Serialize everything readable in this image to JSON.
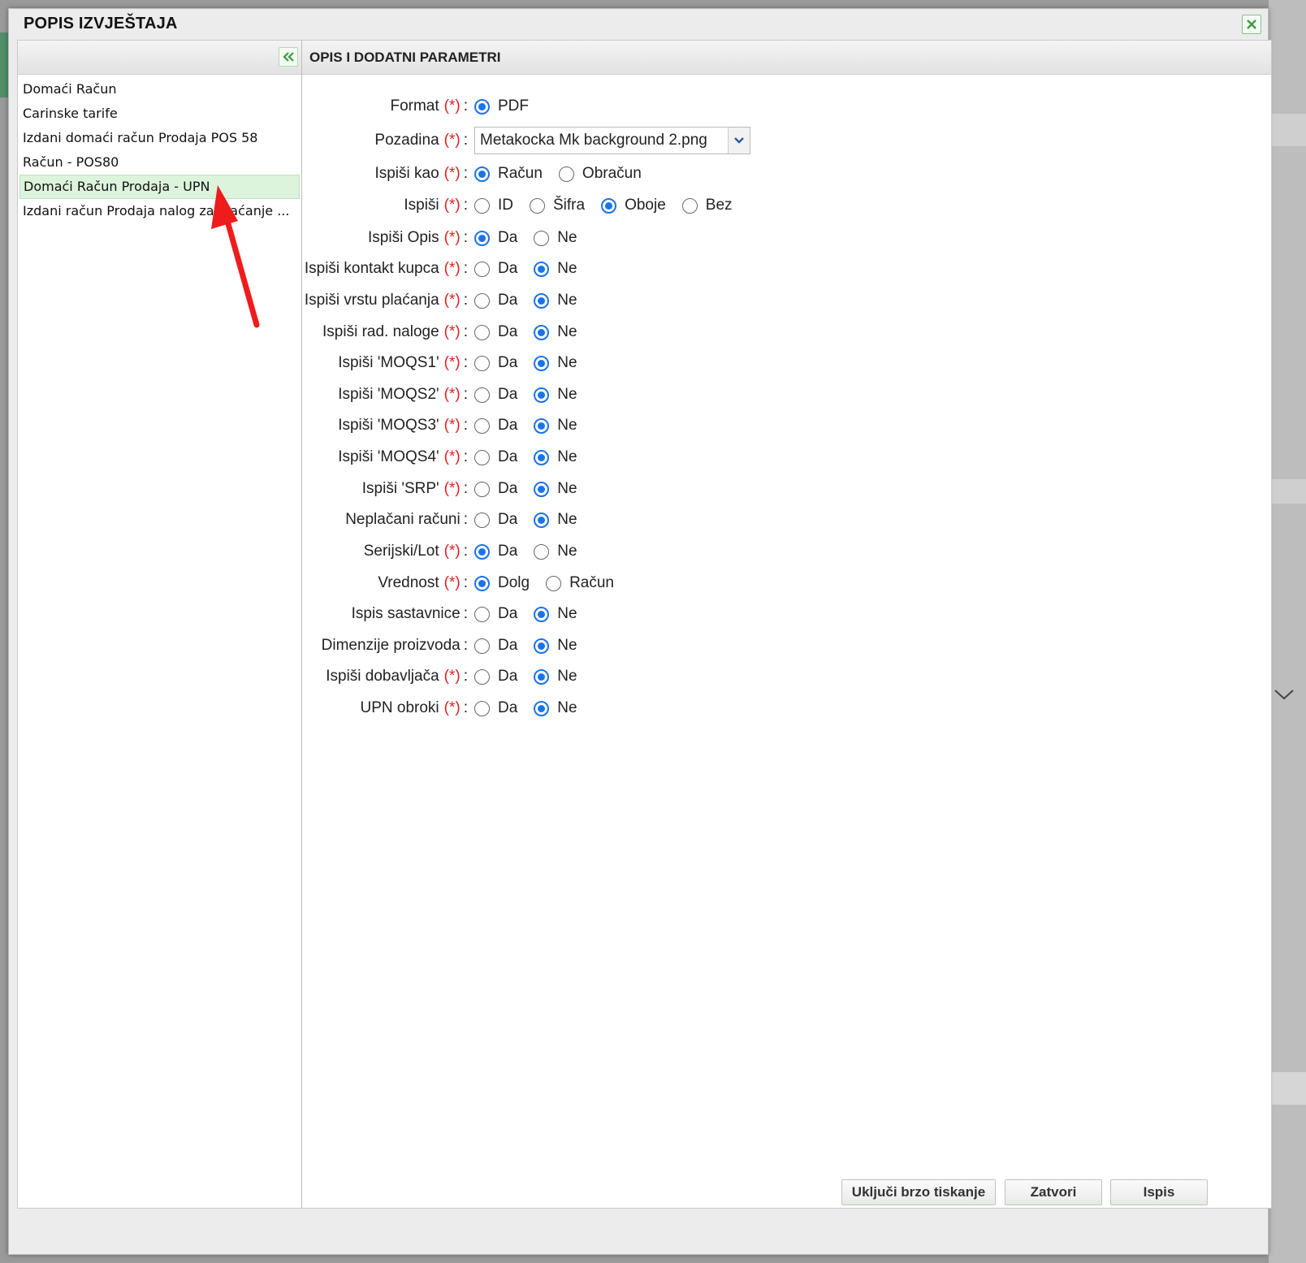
{
  "dialog": {
    "title": "POPIS IZVJEŠTAJA"
  },
  "report_list": {
    "items": [
      {
        "label": "Domaći Račun",
        "selected": false
      },
      {
        "label": "Carinske tarife",
        "selected": false
      },
      {
        "label": "Izdani domaći račun Prodaja POS 58",
        "selected": false
      },
      {
        "label": "Račun - POS80",
        "selected": false
      },
      {
        "label": "Domaći Račun Prodaja - UPN",
        "selected": true
      },
      {
        "label": "Izdani račun Prodaja nalog za plaćanje ...",
        "selected": false
      }
    ]
  },
  "params": {
    "header": "OPIS I DODATNI PARAMETRI",
    "required_marker": "(*)",
    "rows": [
      {
        "label": "Format",
        "required": true,
        "type": "radio",
        "options": [
          {
            "label": "PDF",
            "checked": true
          }
        ]
      },
      {
        "label": "Pozadina",
        "required": true,
        "type": "select",
        "value": "Metakocka Mk background 2.png"
      },
      {
        "label": "Ispiši kao",
        "required": true,
        "type": "radio",
        "options": [
          {
            "label": "Račun",
            "checked": true
          },
          {
            "label": "Obračun",
            "checked": false
          }
        ]
      },
      {
        "label": "Ispiši",
        "required": true,
        "type": "radio",
        "options": [
          {
            "label": "ID",
            "checked": false
          },
          {
            "label": "Šifra",
            "checked": false
          },
          {
            "label": "Oboje",
            "checked": true
          },
          {
            "label": "Bez",
            "checked": false
          }
        ]
      },
      {
        "label": "Ispiši Opis",
        "required": true,
        "type": "radio",
        "options": [
          {
            "label": "Da",
            "checked": true
          },
          {
            "label": "Ne",
            "checked": false
          }
        ]
      },
      {
        "label": "Ispiši kontakt kupca",
        "required": true,
        "type": "radio",
        "options": [
          {
            "label": "Da",
            "checked": false
          },
          {
            "label": "Ne",
            "checked": true
          }
        ]
      },
      {
        "label": "Ispiši vrstu plaćanja",
        "required": true,
        "type": "radio",
        "options": [
          {
            "label": "Da",
            "checked": false
          },
          {
            "label": "Ne",
            "checked": true
          }
        ]
      },
      {
        "label": "Ispiši rad. naloge",
        "required": true,
        "type": "radio",
        "options": [
          {
            "label": "Da",
            "checked": false
          },
          {
            "label": "Ne",
            "checked": true
          }
        ]
      },
      {
        "label": "Ispiši 'MOQS1'",
        "required": true,
        "type": "radio",
        "options": [
          {
            "label": "Da",
            "checked": false
          },
          {
            "label": "Ne",
            "checked": true
          }
        ]
      },
      {
        "label": "Ispiši 'MOQS2'",
        "required": true,
        "type": "radio",
        "options": [
          {
            "label": "Da",
            "checked": false
          },
          {
            "label": "Ne",
            "checked": true
          }
        ]
      },
      {
        "label": "Ispiši 'MOQS3'",
        "required": true,
        "type": "radio",
        "options": [
          {
            "label": "Da",
            "checked": false
          },
          {
            "label": "Ne",
            "checked": true
          }
        ]
      },
      {
        "label": "Ispiši 'MOQS4'",
        "required": true,
        "type": "radio",
        "options": [
          {
            "label": "Da",
            "checked": false
          },
          {
            "label": "Ne",
            "checked": true
          }
        ]
      },
      {
        "label": "Ispiši 'SRP'",
        "required": true,
        "type": "radio",
        "options": [
          {
            "label": "Da",
            "checked": false
          },
          {
            "label": "Ne",
            "checked": true
          }
        ]
      },
      {
        "label": "Neplačani računi",
        "required": false,
        "type": "radio",
        "options": [
          {
            "label": "Da",
            "checked": false
          },
          {
            "label": "Ne",
            "checked": true
          }
        ]
      },
      {
        "label": "Serijski/Lot",
        "required": true,
        "type": "radio",
        "options": [
          {
            "label": "Da",
            "checked": true
          },
          {
            "label": "Ne",
            "checked": false
          }
        ]
      },
      {
        "label": "Vrednost",
        "required": true,
        "type": "radio",
        "options": [
          {
            "label": "Dolg",
            "checked": true
          },
          {
            "label": "Račun",
            "checked": false
          }
        ]
      },
      {
        "label": "Ispis sastavnice",
        "required": false,
        "type": "radio",
        "options": [
          {
            "label": "Da",
            "checked": false
          },
          {
            "label": "Ne",
            "checked": true
          }
        ]
      },
      {
        "label": "Dimenzije proizvoda",
        "required": false,
        "type": "radio",
        "options": [
          {
            "label": "Da",
            "checked": false
          },
          {
            "label": "Ne",
            "checked": true
          }
        ]
      },
      {
        "label": "Ispiši dobavljača",
        "required": true,
        "type": "radio",
        "options": [
          {
            "label": "Da",
            "checked": false
          },
          {
            "label": "Ne",
            "checked": true
          }
        ]
      },
      {
        "label": "UPN obroki",
        "required": true,
        "type": "radio",
        "options": [
          {
            "label": "Da",
            "checked": false
          },
          {
            "label": "Ne",
            "checked": true
          }
        ]
      }
    ]
  },
  "footer": {
    "quick_print_label": "Uključi brzo tiskanje",
    "close_label": "Zatvori",
    "print_label": "Ispis"
  },
  "icons": {
    "close": "close-icon",
    "collapse": "double-chevron-left-icon",
    "dropdown": "chevron-down-icon",
    "annotation": "red-arrow-annotation"
  },
  "colors": {
    "accent": "#1a73e8",
    "required": "#e02020",
    "selected_row": "#dcf3dc",
    "icon_green": "#3c9a3c",
    "annotation": "#ee1c1c"
  }
}
